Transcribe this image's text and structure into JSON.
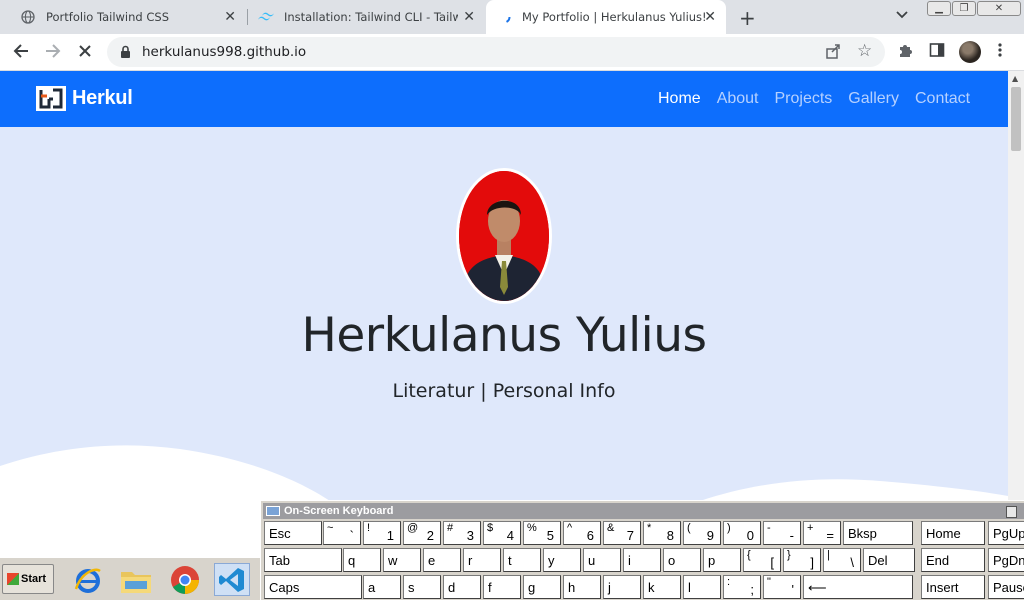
{
  "browser": {
    "tabs": [
      {
        "title": "Portfolio Tailwind CSS",
        "icon": "globe-icon"
      },
      {
        "title": "Installation: Tailwind CLI - Tailwind CSS",
        "icon": "tailwind-icon"
      },
      {
        "title": "My Portfolio | Herkulanus Yulius!",
        "icon": "loading-icon",
        "active": true
      }
    ],
    "url": "herkulanus998.github.io",
    "accent": "#0d6efd"
  },
  "site": {
    "brand": "Herkul",
    "nav": [
      "Home",
      "About",
      "Projects",
      "Gallery",
      "Contact"
    ],
    "active_nav": "Home",
    "hero_name": "Herkulanus Yulius",
    "hero_sub": "Literatur | Personal Info"
  },
  "taskbar": {
    "start_label": "Start",
    "apps": [
      "internet-explorer-icon",
      "file-explorer-icon",
      "chrome-icon",
      "vscode-icon"
    ]
  },
  "osk": {
    "title": "On-Screen Keyboard",
    "rows": [
      [
        "Esc",
        "~ `",
        "! 1",
        "@ 2",
        "# 3",
        "$ 4",
        "% 5",
        "^ 6",
        "& 7",
        "* 8",
        "( 9",
        ") 0",
        "- -",
        "+ =",
        "Bksp",
        "Home",
        "PgUp"
      ],
      [
        "Tab",
        "q",
        "w",
        "e",
        "r",
        "t",
        "y",
        "u",
        "i",
        "o",
        "p",
        "{ [",
        "} ]",
        "| \\",
        "Del",
        "End",
        "PgDn"
      ],
      [
        "Caps",
        "a",
        "s",
        "d",
        "f",
        "g",
        "h",
        "j",
        "k",
        "l",
        ": ;",
        "\" '",
        "⟵",
        "Insert",
        "Pause"
      ]
    ]
  }
}
